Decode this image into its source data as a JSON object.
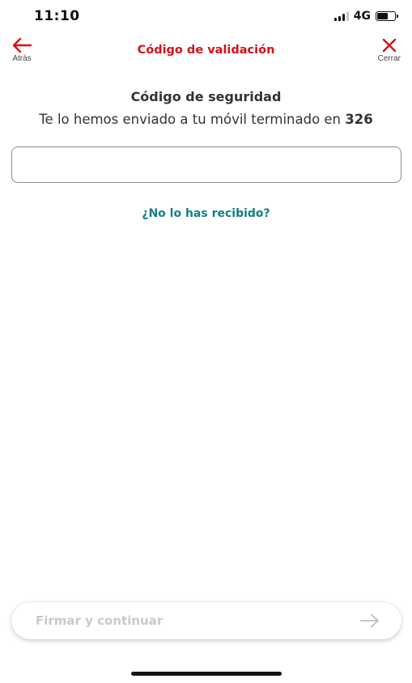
{
  "status_bar": {
    "time": "11:10",
    "network": "4G"
  },
  "nav": {
    "back_label": "Atrás",
    "title": "Código de validación",
    "close_label": "Cerrar",
    "accent_color": "#d60f17"
  },
  "content": {
    "heading": "Código de seguridad",
    "sent_text": "Te lo hemos enviado a tu móvil terminado en",
    "phone_suffix": "326",
    "code_input_value": "",
    "resend_link": "¿No lo has recibido?",
    "link_color": "#137e84"
  },
  "footer": {
    "continue_label": "Firmar y continuar",
    "continue_icon": "arrow-right-icon"
  }
}
